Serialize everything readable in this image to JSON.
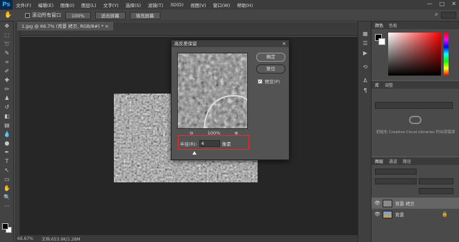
{
  "menubar": {
    "logo": "Ps",
    "items": [
      "文件(F)",
      "编辑(E)",
      "图像(I)",
      "图层(L)",
      "文字(Y)",
      "选择(S)",
      "滤镜(T)",
      "3D(D)",
      "视图(V)",
      "窗口(W)",
      "帮助(H)"
    ],
    "minimize": "—",
    "maximize": "□",
    "close": "✕"
  },
  "options": {
    "scroll_all_label": "滚动所有窗口",
    "zoom_value": "100%",
    "fit_screen": "适合屏幕",
    "fill_screen": "填充屏幕"
  },
  "document": {
    "tab_title": "1.jpg @ 66.7% (背景 拷贝, RGB/8#) *  ×",
    "zoom": "66.67%",
    "doc_size": "文档:653.9K/1.28M"
  },
  "dialog": {
    "title": "高反差保留",
    "close": "×",
    "ok": "确定",
    "reset": "复位",
    "preview_label": "预览(P)",
    "preview_check": "✓",
    "zoom_out": "⊖",
    "zoom_percent": "100%",
    "zoom_in": "⊕",
    "radius_label": "半径(R):",
    "radius_value": "4",
    "radius_unit": "像素"
  },
  "panels": {
    "color_tabs": [
      "颜色",
      "色板"
    ],
    "library_tabs": [
      "库",
      "调整"
    ],
    "library_text": "初始化 Creative Cloud Libraries 时出现错误",
    "layers_tabs": [
      "图层",
      "通道",
      "路径"
    ],
    "layers": [
      {
        "name": "背景 拷贝",
        "selected": true
      },
      {
        "name": "背景",
        "selected": false,
        "locked": true
      }
    ]
  }
}
